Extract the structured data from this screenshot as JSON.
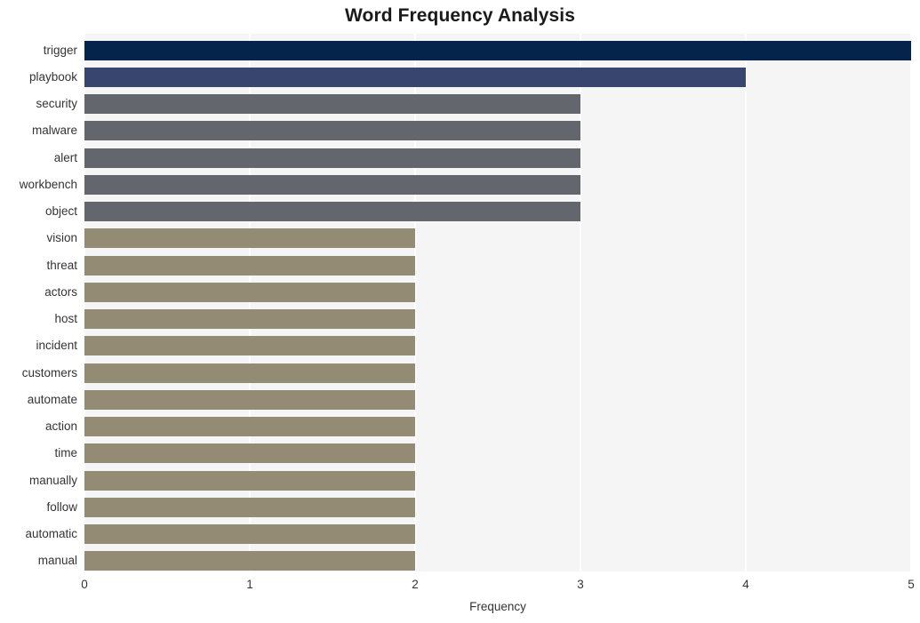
{
  "chart_data": {
    "type": "bar",
    "orientation": "horizontal",
    "title": "Word Frequency Analysis",
    "xlabel": "Frequency",
    "ylabel": "",
    "xlim": [
      0,
      5
    ],
    "xticks": [
      "0",
      "1",
      "2",
      "3",
      "4",
      "5"
    ],
    "grid": "vertical",
    "legend": "none",
    "categories": [
      "trigger",
      "playbook",
      "security",
      "malware",
      "alert",
      "workbench",
      "object",
      "vision",
      "threat",
      "actors",
      "host",
      "incident",
      "customers",
      "automate",
      "action",
      "time",
      "manually",
      "follow",
      "automatic",
      "manual"
    ],
    "values": [
      5,
      4,
      3,
      3,
      3,
      3,
      3,
      2,
      2,
      2,
      2,
      2,
      2,
      2,
      2,
      2,
      2,
      2,
      2,
      2
    ],
    "bar_colors": [
      "#04244c",
      "#38456e",
      "#64666e",
      "#64666e",
      "#64666e",
      "#64666e",
      "#64666e",
      "#938b73",
      "#938b73",
      "#938b73",
      "#938b73",
      "#938b73",
      "#938b73",
      "#938b73",
      "#938b73",
      "#938b73",
      "#938b73",
      "#938b73",
      "#938b73",
      "#938b73"
    ]
  },
  "style": {
    "plot_background": "#f5f5f6",
    "figure_background": "#ffffff",
    "gridline_color": "#ffffff",
    "text_color": "#343434",
    "title_color": "#1a1a1a"
  }
}
